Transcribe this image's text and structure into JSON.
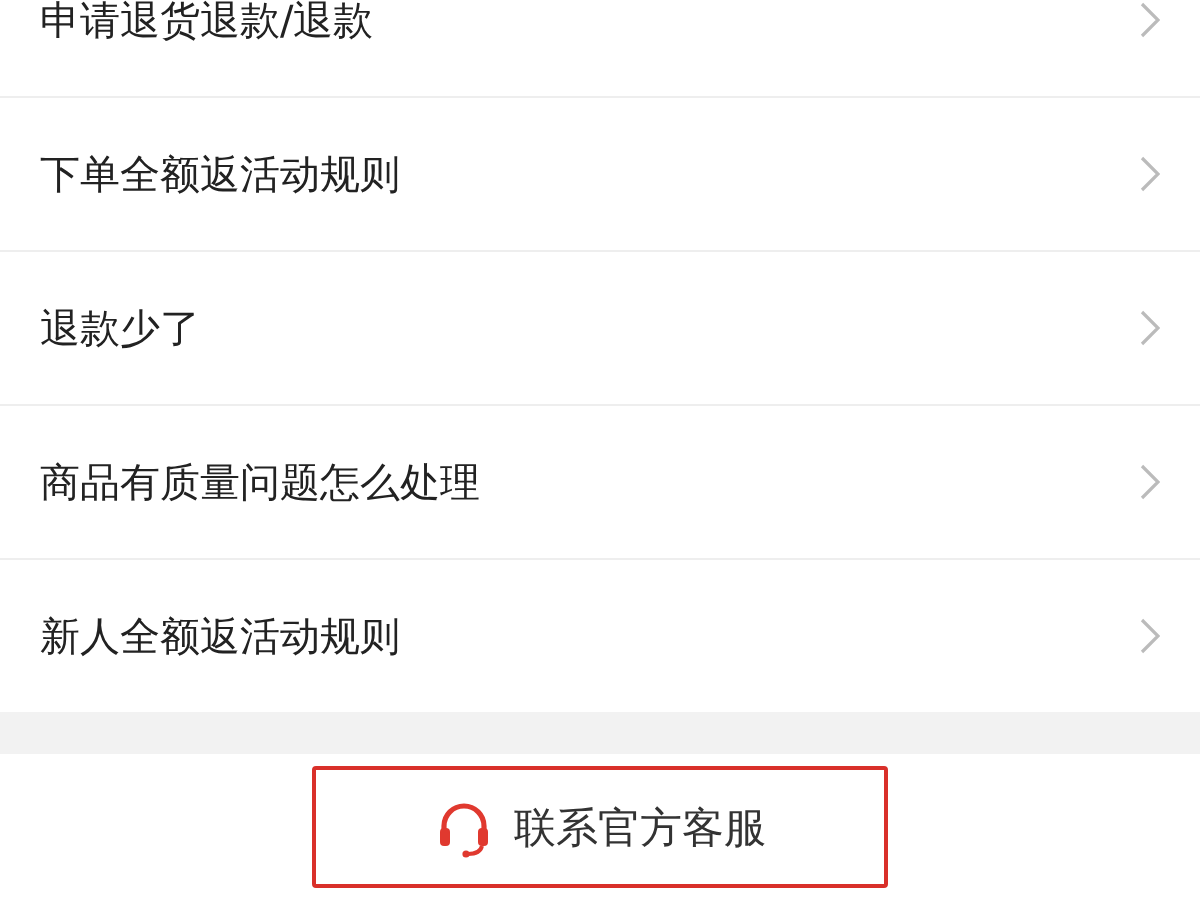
{
  "faq_items": [
    {
      "label": "申请退货退款/退款"
    },
    {
      "label": "下单全额返活动规则"
    },
    {
      "label": "退款少了"
    },
    {
      "label": "商品有质量问题怎么处理"
    },
    {
      "label": "新人全额返活动规则"
    }
  ],
  "contact_button": {
    "label": "联系官方客服"
  }
}
